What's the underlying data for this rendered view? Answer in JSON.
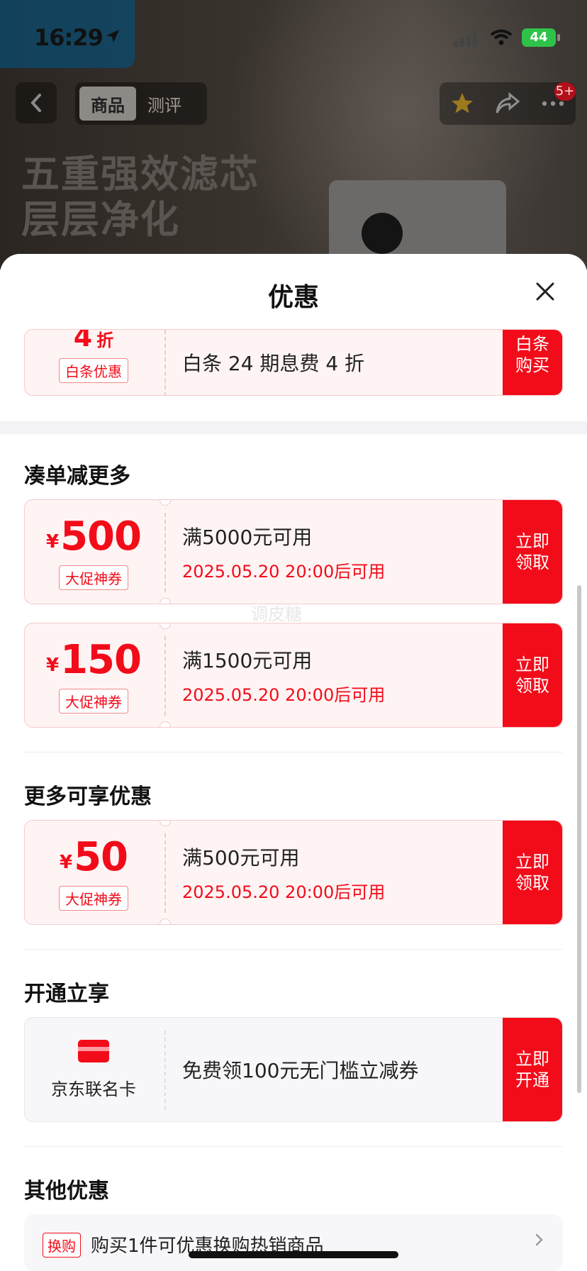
{
  "status": {
    "time": "16:29",
    "battery": "44"
  },
  "nav": {
    "tabs": [
      "商品",
      "测评"
    ],
    "notification_badge": "5+"
  },
  "hero": {
    "line1": "五重强效滤芯",
    "line2": "层层净化"
  },
  "sheet": {
    "title": "优惠",
    "top_partial": {
      "amount": "4",
      "unit": "折",
      "tag": "白条优惠",
      "text": "白条 24 期息费 4 折",
      "cta": [
        "白条",
        "购买"
      ]
    },
    "sections": {
      "more_off": {
        "title": "凑单减更多",
        "coupons": [
          {
            "yen": "¥",
            "amount": "500",
            "tag": "大促神券",
            "condition": "满5000元可用",
            "date": "2025.05.20 20:00后可用",
            "cta": [
              "立即",
              "领取"
            ]
          },
          {
            "yen": "¥",
            "amount": "150",
            "tag": "大促神券",
            "condition": "满1500元可用",
            "date": "2025.05.20 20:00后可用",
            "cta": [
              "立即",
              "领取"
            ]
          }
        ]
      },
      "more_benefits": {
        "title": "更多可享优惠",
        "coupons": [
          {
            "yen": "¥",
            "amount": "50",
            "tag": "大促神券",
            "condition": "满500元可用",
            "date": "2025.05.20 20:00后可用",
            "cta": [
              "立即",
              "领取"
            ]
          }
        ]
      },
      "open_now": {
        "title": "开通立享",
        "card_name": "京东联名卡",
        "offer": "免费领100元无门槛立减券",
        "cta": [
          "立即",
          "开通"
        ]
      },
      "other": {
        "title": "其他优惠",
        "tag": "换购",
        "text": "购买1件可优惠换购热销商品"
      }
    }
  },
  "watermark": "调皮糖"
}
